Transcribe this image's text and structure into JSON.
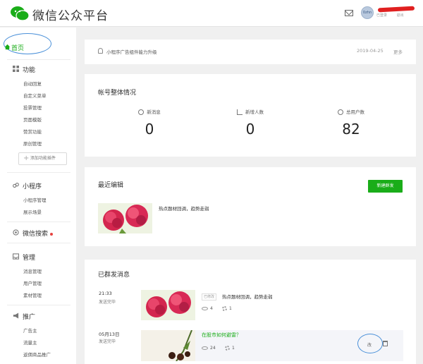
{
  "header": {
    "brand": "微信公众平台",
    "avatar_text": "0zhn",
    "user_links": [
      "已登录",
      "退出"
    ]
  },
  "sidebar": {
    "home": "首页",
    "groups": [
      {
        "title": "功能",
        "icon": "grid-icon",
        "items": [
          "自动回复",
          "自定义菜单",
          "投票管理",
          "页面模版",
          "赞赏功能",
          "原创管理"
        ]
      },
      {
        "title": "小程序",
        "icon": "link-icon",
        "items": [
          "小程序管理",
          "展示场景"
        ]
      },
      {
        "title": "微信搜索",
        "icon": "search-badge-icon",
        "items": []
      },
      {
        "title": "管理",
        "icon": "inbox-icon",
        "items": [
          "消息管理",
          "用户管理",
          "素材管理"
        ]
      },
      {
        "title": "推广",
        "icon": "megaphone-icon",
        "items": [
          "广告主",
          "流量主",
          "返佣商品推广"
        ]
      }
    ],
    "add_plugin": "添加功能插件"
  },
  "notice": {
    "text": "小程序广告组件能力升级",
    "date": "2019-04-25",
    "more": "更多"
  },
  "overview": {
    "title": "帐号整体情况",
    "stats": [
      {
        "label": "新消息",
        "value": "0",
        "icon": "message-icon"
      },
      {
        "label": "新增人数",
        "value": "0",
        "icon": "trend-icon"
      },
      {
        "label": "总用户数",
        "value": "82",
        "icon": "user-icon"
      }
    ]
  },
  "recent": {
    "title": "最近编辑",
    "new_button": "新建群发",
    "item_title": "热点题材回调，趋势走弱"
  },
  "sent": {
    "title": "已群发消息",
    "rows": [
      {
        "time": "21:33",
        "status": "发送完毕",
        "tag": "已修改",
        "title": "热点题材回调，趋势走弱",
        "views": "4",
        "likes": "1"
      },
      {
        "time": "05月13日",
        "status": "发送完毕",
        "title": "在股市如何避雷？",
        "views": "24",
        "likes": "1",
        "edit": "改"
      }
    ]
  },
  "colors": {
    "accent": "#1aad19",
    "highlight": "#4a90d9"
  }
}
